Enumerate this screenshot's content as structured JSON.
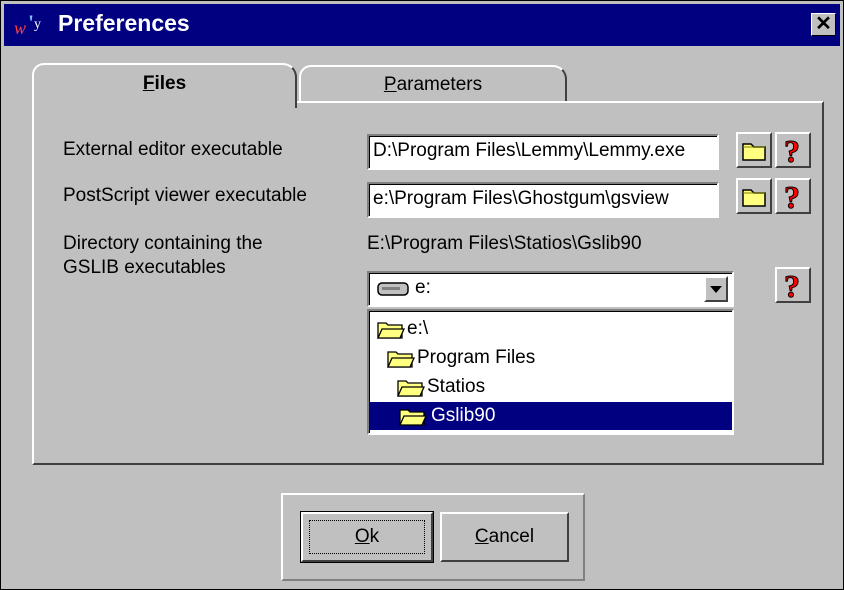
{
  "window": {
    "title": "Preferences",
    "close_label": "✕"
  },
  "tabs": [
    {
      "label_prefix": "",
      "mnemonic": "F",
      "label_rest": "iles",
      "active": true
    },
    {
      "label_prefix": "",
      "mnemonic": "P",
      "label_rest": "arameters",
      "active": false
    }
  ],
  "fields": {
    "editor_label": "External editor executable",
    "editor_value": "D:\\Program Files\\Lemmy\\Lemmy.exe",
    "viewer_label": "PostScript viewer executable",
    "viewer_value": "e:\\Program Files\\Ghostgum\\gsview",
    "dir_label_line1": "Directory containing the",
    "dir_label_line2": "GSLIB executables",
    "dir_value": "E:\\Program Files\\Statios\\Gslib90"
  },
  "drive_combo": {
    "selected": "e:"
  },
  "tree": [
    {
      "label": "e:\\"
    },
    {
      "label": "Program Files"
    },
    {
      "label": "Statios"
    },
    {
      "label": "Gslib90",
      "selected": true
    }
  ],
  "buttons": {
    "ok": {
      "mnemonic": "O",
      "rest": "k"
    },
    "cancel": {
      "mnemonic": "C",
      "rest": "ancel"
    }
  },
  "icons": {
    "folder": "folder-icon",
    "help": "help-icon"
  },
  "colors": {
    "titlebar": "#000080",
    "selection": "#000080",
    "help_red": "#ff0000",
    "folder_yellow": "#ffff80"
  }
}
